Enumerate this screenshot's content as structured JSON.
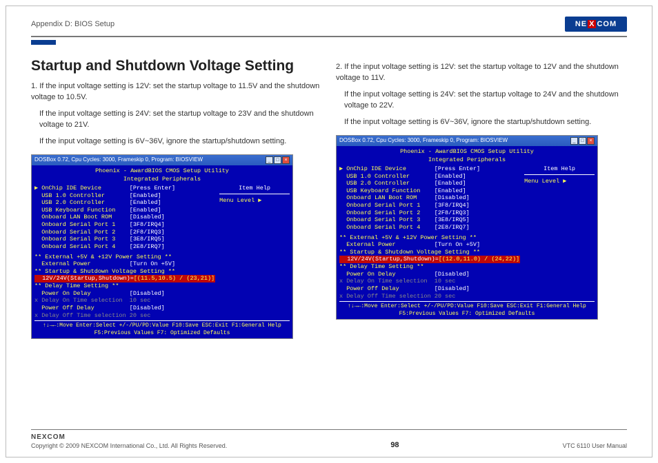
{
  "header": {
    "appendix": "Appendix D: BIOS Setup",
    "logo": {
      "pre": "NE",
      "x": "X",
      "post": "COM"
    }
  },
  "title": "Startup and Shutdown Voltage Setting",
  "col1": {
    "p1": "1. If the input voltage setting is 12V: set the startup voltage to 11.5V and the shutdown voltage to 10.5V.",
    "p2": "If the input voltage setting is 24V: set the startup voltage to 23V and the shutdown voltage to 21V.",
    "p3": "If the input voltage setting is 6V~36V, ignore the startup/shutdown setting."
  },
  "col2": {
    "p1": "2. If the input voltage setting is 12V: set the startup voltage to 12V and the shutdown voltage to 11V.",
    "p2": "If the input voltage setting is 24V: set the startup voltage to 24V and the shutdown voltage to 22V.",
    "p3": "If the input voltage setting is 6V~36V, ignore the startup/shutdown setting."
  },
  "bios": {
    "titlebar": "DOSBox 0.72, Cpu Cycles:   3000, Frameskip  0, Program: BIOSVIEW",
    "head1": "Phoenix - AwardBIOS CMOS Setup Utility",
    "head2": "Integrated Peripherals",
    "items": [
      {
        "label": "▶ OnChip IDE Device",
        "value": "[Press Enter]"
      },
      {
        "label": "  USB 1.0 Controller",
        "value": "[Enabled]"
      },
      {
        "label": "  USB 2.0 Controller",
        "value": "[Enabled]"
      },
      {
        "label": "  USB Keyboard Function",
        "value": "[Enabled]"
      },
      {
        "label": "  Onboard LAN Boot ROM",
        "value": "[Disabled]"
      },
      {
        "label": "  Onboard Serial Port 1",
        "value": "[3F8/IRQ4]"
      },
      {
        "label": "  Onboard Serial Port 2",
        "value": "[2F8/IRQ3]"
      },
      {
        "label": "  Onboard Serial Port 3",
        "value": "[3E8/IRQ5]"
      },
      {
        "label": "  Onboard Serial Port 4",
        "value": "[2E8/IRQ7]"
      }
    ],
    "sec1": "** External +5V & +12V Power Setting **",
    "ext": {
      "label": "  External Power",
      "value": "[Turn On +5V]"
    },
    "sec2": "** Startup & Shutdown Voltage Setting **",
    "hl1": {
      "label": "  12V/24V(Startup,Shutdown)=",
      "value": "[(11.5,10.5) / (23,21)]"
    },
    "hl2": {
      "label": "  12V/24V(Startup,Shutdown)=",
      "value": "[(12.0,11.0) / (24,22)]"
    },
    "sec3": "** Delay Time Setting **",
    "pon": {
      "label": "  Power On Delay",
      "value": "[Disabled]"
    },
    "ponsel": {
      "label": "x Delay On Time selection",
      "value": "10 sec"
    },
    "pof": {
      "label": "  Power Off Delay",
      "value": "[Disabled]"
    },
    "pofsel": {
      "label": "x Delay Off Time selection",
      "value": "20 sec"
    },
    "help1": "Item Help",
    "help2": "Menu Level   ▶",
    "foot1": "↑↓→←:Move   Enter:Select  +/-/PU/PD:Value  F10:Save  ESC:Exit  F1:General Help",
    "foot2": "F5:Previous Values              F7: Optimized Defaults"
  },
  "footer": {
    "logo": "NEXCOM",
    "copyright": "Copyright © 2009 NEXCOM International Co., Ltd. All Rights Reserved.",
    "page": "98",
    "doc": "VTC 6110 User Manual"
  }
}
